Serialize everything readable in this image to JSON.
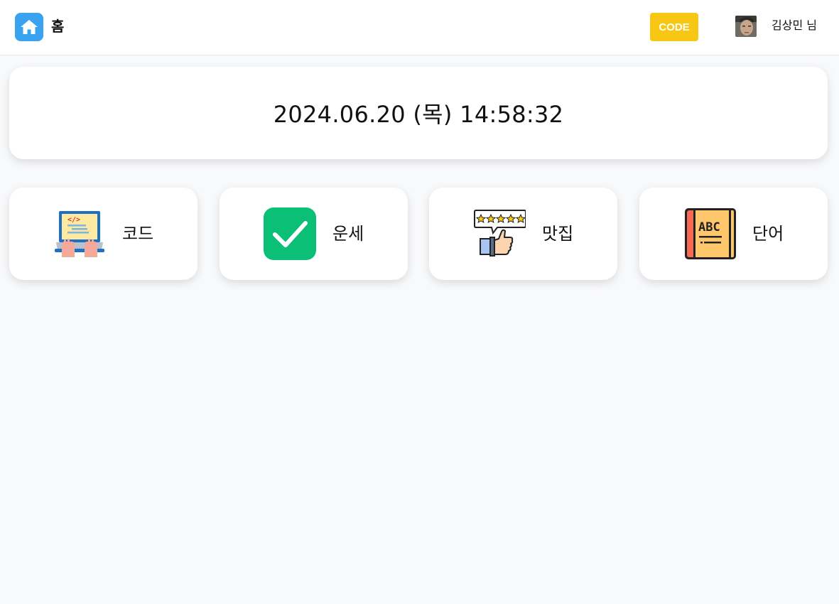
{
  "header": {
    "home_label": "홈",
    "code_button": "CODE",
    "user_name": "김상민 님",
    "colors": {
      "home_button": "#3aa3f0",
      "code_button": "#f8c713"
    }
  },
  "clock": {
    "datetime": "2024.06.20 (목) 14:58:32"
  },
  "menu": [
    {
      "label": "코드",
      "icon": "laptop-code-icon"
    },
    {
      "label": "운세",
      "icon": "checkmark-icon"
    },
    {
      "label": "맛집",
      "icon": "rating-thumbs-up-icon"
    },
    {
      "label": "단어",
      "icon": "abc-book-icon"
    }
  ]
}
